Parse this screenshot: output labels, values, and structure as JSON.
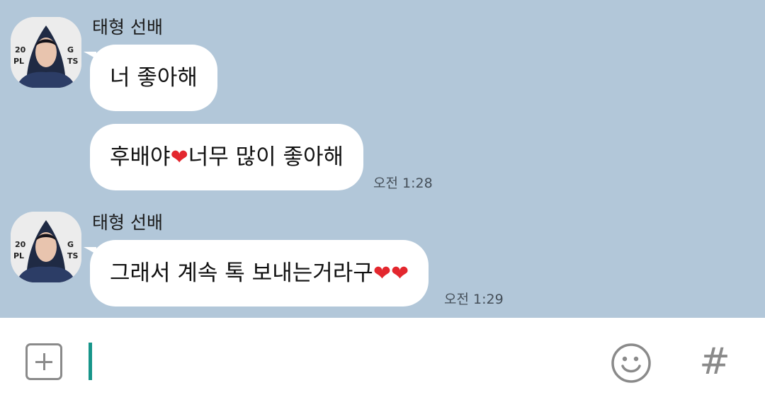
{
  "chat": {
    "background_color": "#b2c7d9",
    "groups": [
      {
        "sender": "태형 선배",
        "messages": [
          {
            "text": "너 좋아해",
            "time": ""
          },
          {
            "text_before": "후배야",
            "heart": "❤",
            "text_after": "너무 많이 좋아해",
            "time": "오전 1:28"
          }
        ]
      },
      {
        "sender": "태형 선배",
        "messages": [
          {
            "text": "그래서 계속 톡 보내는거라구",
            "hearts": "❤❤",
            "time": "오전 1:29"
          }
        ]
      }
    ]
  },
  "input_bar": {
    "plus_icon": "plus-square-icon",
    "text_value": "",
    "cursor_color": "#17958a",
    "emoji_icon": "smiley-icon",
    "hash_icon": "hashtag-icon",
    "hash_glyph": "#"
  },
  "colors": {
    "bubble": "#ffffff",
    "heart": "#e3272e",
    "icon_gray": "#8a8a8a"
  }
}
